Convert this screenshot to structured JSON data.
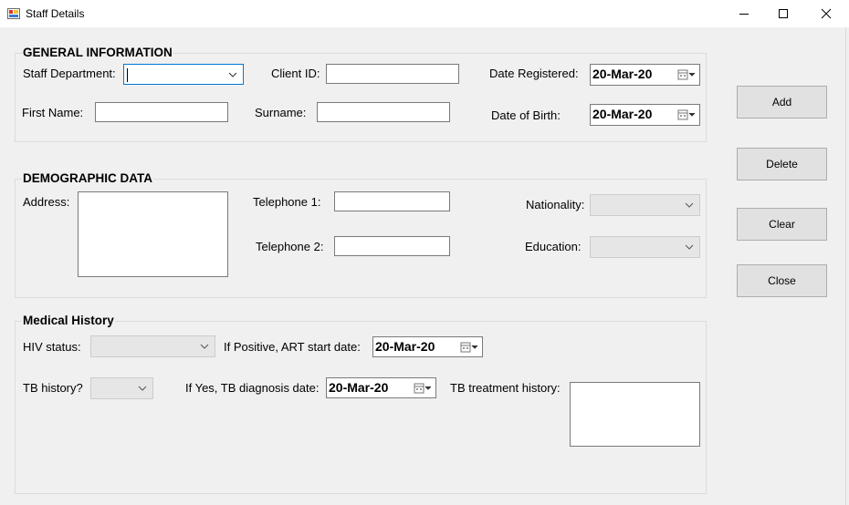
{
  "window": {
    "title": "Staff Details",
    "icons": {
      "app": "form-icon",
      "minimize": "minimize-icon",
      "maximize": "maximize-icon",
      "close": "close-icon"
    }
  },
  "general": {
    "title": "GENERAL INFORMATION",
    "staff_department_label": "Staff Department:",
    "staff_department_value": "",
    "client_id_label": "Client ID:",
    "client_id_value": "",
    "date_registered_label": "Date Registered:",
    "date_registered_value": "20-Mar-20",
    "first_name_label": "First Name:",
    "first_name_value": "",
    "surname_label": "Surname:",
    "surname_value": "",
    "dob_label": "Date of Birth:",
    "dob_value": "20-Mar-20"
  },
  "demographic": {
    "title": "DEMOGRAPHIC DATA",
    "address_label": "Address:",
    "address_value": "",
    "telephone1_label": "Telephone 1:",
    "telephone1_value": "",
    "telephone2_label": "Telephone 2:",
    "telephone2_value": "",
    "nationality_label": "Nationality:",
    "nationality_value": "",
    "education_label": "Education:",
    "education_value": ""
  },
  "medical": {
    "title": "Medical History",
    "hiv_status_label": "HIV status:",
    "hiv_status_value": "",
    "art_start_label": "If Positive, ART start date:",
    "art_start_value": "20-Mar-20",
    "tb_history_label": "TB history?",
    "tb_history_value": "",
    "tb_diagnosis_label": "If Yes, TB diagnosis date:",
    "tb_diagnosis_value": "20-Mar-20",
    "tb_treatment_label": "TB treatment history:",
    "tb_treatment_value": ""
  },
  "buttons": {
    "add": "Add",
    "delete": "Delete",
    "clear": "Clear",
    "close": "Close"
  },
  "colors": {
    "window_bg": "#f0f0f0",
    "titlebar_bg": "#ffffff",
    "focus_border": "#0078d7",
    "button_bg": "#e1e1e1"
  }
}
